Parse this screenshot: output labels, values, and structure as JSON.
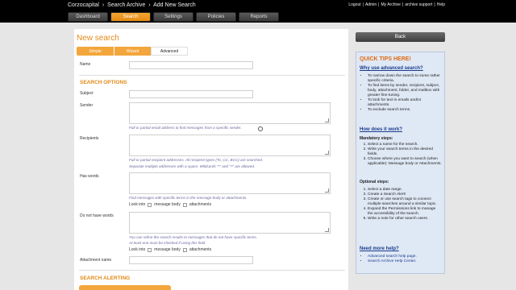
{
  "header": {
    "breadcrumb": [
      "Corzocapital",
      "›",
      "Search Archive",
      "›",
      "Add New Search"
    ],
    "top_links": [
      "Logout",
      "|",
      "Admin",
      "|",
      "My Archive",
      "|",
      "archive support",
      "|",
      "Help"
    ],
    "tabs": [
      {
        "label": "Dashboard",
        "active": false
      },
      {
        "label": "Search",
        "active": true
      },
      {
        "label": "Settings",
        "active": false
      },
      {
        "label": "Policies",
        "active": false
      },
      {
        "label": "Reports",
        "active": false
      }
    ]
  },
  "main": {
    "title": "New search",
    "modes": [
      "Simple",
      "Wizard",
      "Advanced"
    ],
    "name_label": "Name",
    "search_options_title": "SEARCH OPTIONS",
    "subject_label": "Subject",
    "sender_label": "Sender",
    "sender_hint": "Full or partial email address to find messages from a specific sender.",
    "recipients_label": "Recipients",
    "recipients_hint1": "Full or partial recipient addresses. All recipient types (To, CC, BCC) are searched.",
    "recipients_hint2": "Separate multiple addresses with a space. Wildcards \"*\" and \"?\" are allowed.",
    "has_words_label": "Has words",
    "has_words_hint": "Find messages with specific terms in the message body or attachments.",
    "look_into": "Look into",
    "message_body": "message body",
    "attachments": "attachments",
    "not_have_label": "Do not have words",
    "not_have_hint1": "You can refine the search results to messages that do not have specific terms.",
    "not_have_hint2": "At least one must be checked if using this field.",
    "attachment_name_label": "Attachment name",
    "search_alerting_title": "SEARCH ALERTING"
  },
  "sidebar": {
    "back_label": "Back",
    "tips_title": "QUICK TIPS HERE!",
    "why_title": "Why use advanced search?",
    "why_items": [
      "To narrow down the search to some rather specific criteria.",
      "To find items by sender, recipient, subject, body, attachment, folder, and mailbox with greater fine-tuning.",
      "To look for text in emails and/or attachments.",
      "To exclude search terms."
    ],
    "how_title": "How does it work?",
    "mandatory_label": "Mandatory steps:",
    "mandatory_items": [
      "Select a name for the search.",
      "Write your search terms in the desired fields.",
      "Choose where you want to search (when applicable): Message body or Attachments."
    ],
    "optional_label": "Optional steps:",
    "optional_items": [
      "Select a date range.",
      "Create a Search Alert!",
      "Create or use search tags to connect multiple searches around a similar topic.",
      "Expand the Permissions link to manage the accessibility of the search.",
      "Write a note for other search users."
    ],
    "need_help": "Need more help?",
    "help_items": [
      "Advanced search help page.",
      "Search Archive Help Center."
    ]
  }
}
